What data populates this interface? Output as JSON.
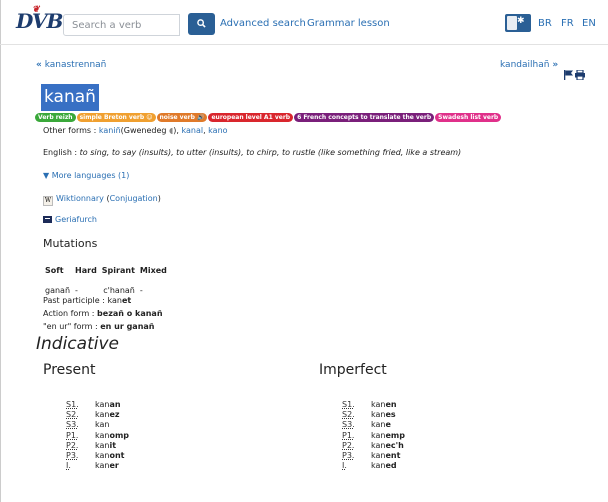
{
  "header": {
    "logo_text": "DVB",
    "search_placeholder": "Search a verb",
    "advanced_search": "Advanced search",
    "grammar_lesson": "Grammar lesson",
    "languages": [
      "BR",
      "FR",
      "EN"
    ],
    "toggle_on": true
  },
  "nav": {
    "prev_arrow": "«",
    "prev_label": "kanastrennañ",
    "next_label": "kandailhañ",
    "next_arrow": "»"
  },
  "verb": {
    "title": "kanañ",
    "tags": [
      {
        "label": "Verb reizh",
        "color": "#3aa83a"
      },
      {
        "label": "simple Breton verb ☺",
        "color": "#f0a030"
      },
      {
        "label": "noise verb 🔊",
        "color": "#e07a2a"
      },
      {
        "label": "european level A1 verb",
        "color": "#d9262d"
      },
      {
        "label": "6 French concepts to translate the verb",
        "color": "#7a1f7a"
      },
      {
        "label": "Swadesh list verb",
        "color": "#e0308a"
      }
    ],
    "other_forms_label": "Other forms :",
    "other_form_1": "kaniñ",
    "other_form_1_note": "(Gwenedeg",
    "other_form_1_close": ")",
    "other_form_2": "kanal",
    "other_form_3": "kano",
    "english_label": "English :",
    "english_text": "to sing, to say (insults), to utter (insults), to chirp, to rustle (like something fried, like a stream)",
    "more_languages": "▼ More languages (1)",
    "wiktionary": "Wiktionnary",
    "conjugation": "Conjugation",
    "geriafurch": "Geriafurch"
  },
  "mutations": {
    "heading": "Mutations",
    "headers": [
      "Soft",
      "Hard",
      "Spirant",
      "Mixed"
    ],
    "values": [
      "ganañ",
      "-",
      "c'hanañ",
      "-"
    ]
  },
  "forms": {
    "past_participle_label": "Past participle :",
    "past_participle_stem": "kan",
    "past_participle_end": "et",
    "action_form_label": "Action form :",
    "action_form_value": "bezañ o kanañ",
    "en_ur_label": "\"en ur\" form :",
    "en_ur_value": "en ur ganañ"
  },
  "indicative": {
    "heading": "Indicative",
    "present": {
      "title": "Present",
      "rows": [
        {
          "person": "S1.",
          "stem": "kan",
          "ending": "an"
        },
        {
          "person": "S2.",
          "stem": "kan",
          "ending": "ez"
        },
        {
          "person": "S3.",
          "stem": "kan",
          "ending": ""
        },
        {
          "person": "P1.",
          "stem": "kan",
          "ending": "omp"
        },
        {
          "person": "P2.",
          "stem": "kan",
          "ending": "it"
        },
        {
          "person": "P3.",
          "stem": "kan",
          "ending": "ont"
        },
        {
          "person": "I.",
          "stem": "kan",
          "ending": "er"
        }
      ]
    },
    "imperfect": {
      "title": "Imperfect",
      "rows": [
        {
          "person": "S1.",
          "stem": "kan",
          "ending": "en"
        },
        {
          "person": "S2.",
          "stem": "kan",
          "ending": "es"
        },
        {
          "person": "S3.",
          "stem": "kan",
          "ending": "e"
        },
        {
          "person": "P1.",
          "stem": "kan",
          "ending": "emp"
        },
        {
          "person": "P2.",
          "stem": "kan",
          "ending": "ec'h"
        },
        {
          "person": "P3.",
          "stem": "kan",
          "ending": "ent"
        },
        {
          "person": "I.",
          "stem": "kan",
          "ending": "ed"
        }
      ]
    }
  }
}
